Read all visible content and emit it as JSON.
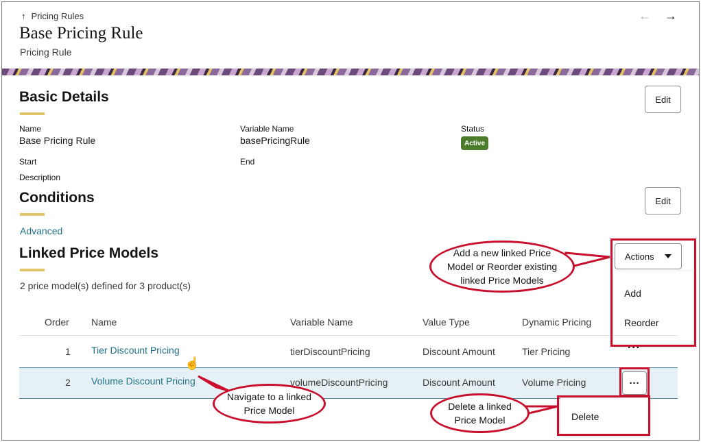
{
  "header": {
    "breadcrumb": "Pricing Rules",
    "title": "Base Pricing Rule",
    "subtitle": "Pricing Rule",
    "prev_icon": "arrow-left-icon",
    "next_icon": "arrow-right-icon"
  },
  "basic_details": {
    "title": "Basic Details",
    "edit_label": "Edit",
    "fields": {
      "name_label": "Name",
      "name_value": "Base Pricing Rule",
      "variable_name_label": "Variable Name",
      "variable_name_value": "basePricingRule",
      "status_label": "Status",
      "status_value": "Active",
      "start_label": "Start",
      "end_label": "End",
      "description_label": "Description"
    }
  },
  "conditions": {
    "title": "Conditions",
    "edit_label": "Edit",
    "advanced_link": "Advanced"
  },
  "linked_models": {
    "title": "Linked Price Models",
    "summary": "2 price model(s) defined for 3 product(s)",
    "actions_label": "Actions",
    "menu": [
      "Add",
      "Reorder"
    ],
    "columns": [
      "Order",
      "Name",
      "Variable Name",
      "Value Type",
      "Dynamic Pricing"
    ],
    "rows": [
      {
        "order": "1",
        "name": "Tier Discount Pricing",
        "variable_name": "tierDiscountPricing",
        "value_type": "Discount Amount",
        "dynamic_pricing": "Tier Pricing",
        "more": "···"
      },
      {
        "order": "2",
        "name": "Volume Discount Pricing",
        "variable_name": "volumeDiscountPricing",
        "value_type": "Discount Amount",
        "dynamic_pricing": "Volume Pricing",
        "more": "···"
      }
    ],
    "row_menu": [
      "Delete"
    ]
  },
  "callouts": {
    "add_reorder": "Add a new linked Price Model or Reorder existing linked Price Models",
    "navigate": "Navigate to a linked Price Model",
    "delete": "Delete a linked Price Model"
  },
  "colors": {
    "accent_underline": "#e2c66a",
    "link": "#227188",
    "active_badge": "#4d7d2c",
    "annotation_red": "#c8102e",
    "selected_row": "#e6f1f6"
  }
}
